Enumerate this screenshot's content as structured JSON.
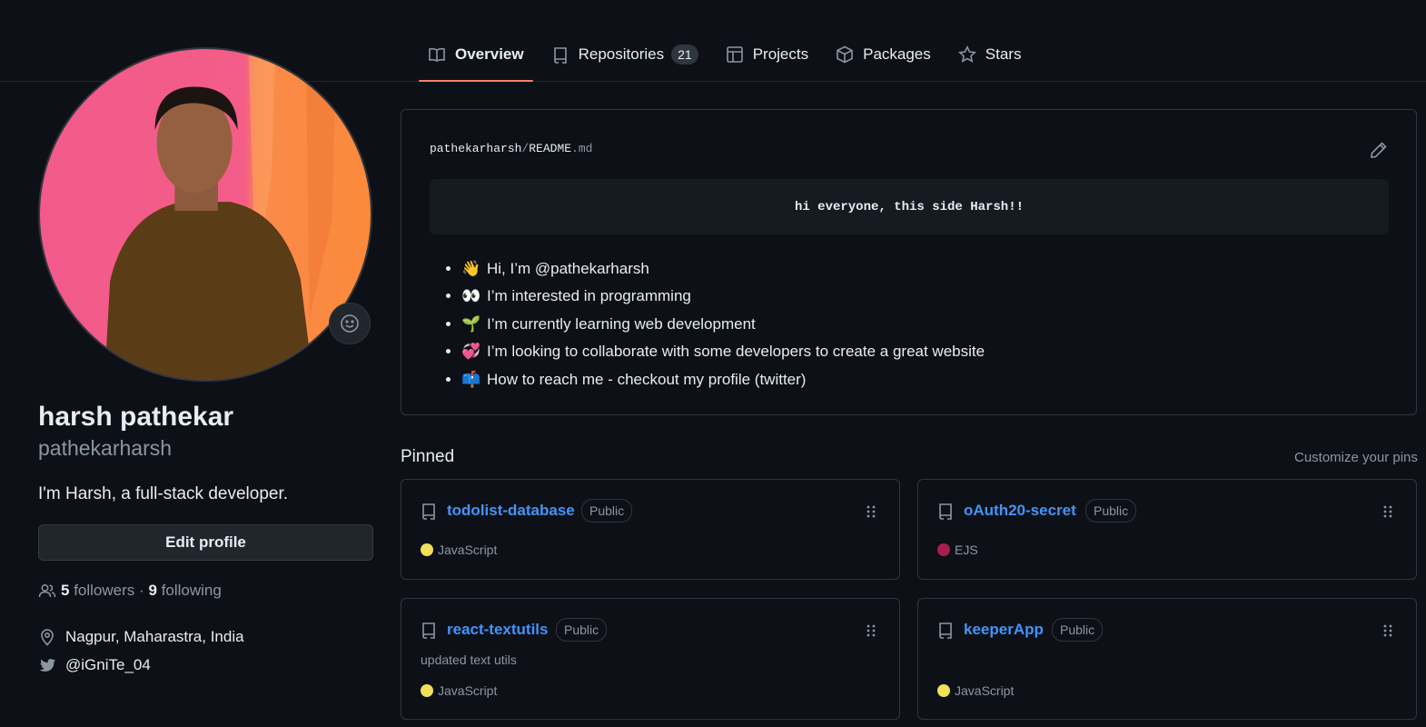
{
  "nav": {
    "tabs": [
      {
        "label": "Overview",
        "icon": "book-icon",
        "active": true
      },
      {
        "label": "Repositories",
        "icon": "repo-icon",
        "count": "21"
      },
      {
        "label": "Projects",
        "icon": "table-icon"
      },
      {
        "label": "Packages",
        "icon": "package-icon"
      },
      {
        "label": "Stars",
        "icon": "star-icon"
      }
    ]
  },
  "profile": {
    "name": "harsh pathekar",
    "username": "pathekarharsh",
    "bio": "I'm Harsh, a full-stack developer.",
    "edit_label": "Edit profile",
    "followers_count": "5",
    "followers_label": "followers",
    "separator": "·",
    "following_count": "9",
    "following_label": "following",
    "location": "Nagpur, Maharastra, India",
    "twitter": "@iGniTe_04"
  },
  "readme": {
    "owner": "pathekarharsh",
    "slash": "/",
    "file_base": "README",
    "file_ext": ".md",
    "code_line": "hi everyone, this side Harsh!!",
    "items": [
      {
        "emoji": "👋",
        "text": "Hi, I’m @pathekarharsh"
      },
      {
        "emoji": "👀",
        "text": "I’m interested in programming"
      },
      {
        "emoji": "🌱",
        "text": "I’m currently learning web development"
      },
      {
        "emoji": "💞",
        "text": "I’m looking to collaborate with some developers to create a great website"
      },
      {
        "emoji": "📫",
        "text": "How to reach me - checkout my profile (twitter)"
      }
    ]
  },
  "pinned": {
    "title": "Pinned",
    "customize": "Customize your pins",
    "repos": [
      {
        "name": "todolist-database",
        "visibility": "Public",
        "description": "",
        "language": "JavaScript",
        "lang_color": "#f1e05a"
      },
      {
        "name": "oAuth20-secret",
        "visibility": "Public",
        "description": "",
        "language": "EJS",
        "lang_color": "#a91e50"
      },
      {
        "name": "react-textutils",
        "visibility": "Public",
        "description": "updated text utils",
        "language": "JavaScript",
        "lang_color": "#f1e05a"
      },
      {
        "name": "keeperApp",
        "visibility": "Public",
        "description": "",
        "language": "JavaScript",
        "lang_color": "#f1e05a"
      }
    ]
  },
  "colors": {
    "accent": "#f78166",
    "link": "#4493f8",
    "background": "#0d1117"
  }
}
